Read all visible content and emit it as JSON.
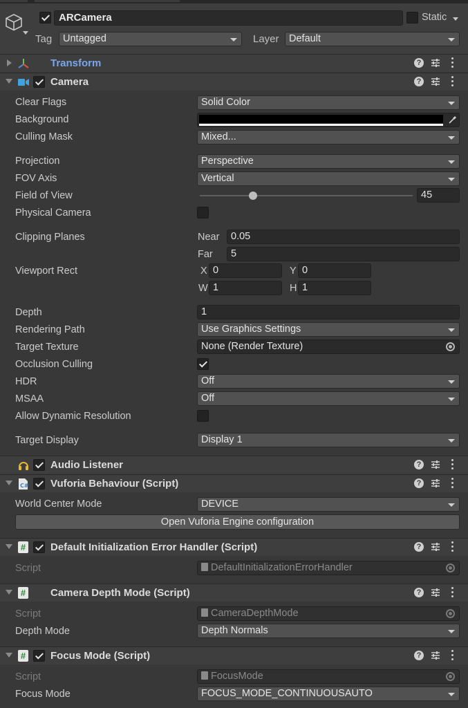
{
  "header": {
    "object_name": "ARCamera",
    "static_label": "Static",
    "tag_label": "Tag",
    "tag_value": "Untagged",
    "layer_label": "Layer",
    "layer_value": "Default"
  },
  "transform": {
    "title": "Transform"
  },
  "camera": {
    "title": "Camera",
    "clear_flags": {
      "label": "Clear Flags",
      "value": "Solid Color"
    },
    "background": {
      "label": "Background",
      "color": "#000000"
    },
    "culling_mask": {
      "label": "Culling Mask",
      "value": "Mixed..."
    },
    "projection": {
      "label": "Projection",
      "value": "Perspective"
    },
    "fov_axis": {
      "label": "FOV Axis",
      "value": "Vertical"
    },
    "field_of_view": {
      "label": "Field of View",
      "value": "45",
      "slider_fraction": 0.25
    },
    "physical_camera": {
      "label": "Physical Camera",
      "checked": false
    },
    "clipping_planes": {
      "label": "Clipping Planes",
      "near_label": "Near",
      "near_value": "0.05",
      "far_label": "Far",
      "far_value": "5"
    },
    "viewport_rect": {
      "label": "Viewport Rect",
      "x_label": "X",
      "x_value": "0",
      "y_label": "Y",
      "y_value": "0",
      "w_label": "W",
      "w_value": "1",
      "h_label": "H",
      "h_value": "1"
    },
    "depth": {
      "label": "Depth",
      "value": "1"
    },
    "rendering_path": {
      "label": "Rendering Path",
      "value": "Use Graphics Settings"
    },
    "target_texture": {
      "label": "Target Texture",
      "value": "None (Render Texture)"
    },
    "occlusion_culling": {
      "label": "Occlusion Culling",
      "checked": true
    },
    "hdr": {
      "label": "HDR",
      "value": "Off"
    },
    "msaa": {
      "label": "MSAA",
      "value": "Off"
    },
    "allow_dynamic_resolution": {
      "label": "Allow Dynamic Resolution",
      "checked": false
    },
    "target_display": {
      "label": "Target Display",
      "value": "Display 1"
    }
  },
  "audio_listener": {
    "title": "Audio Listener"
  },
  "vuforia": {
    "title": "Vuforia Behaviour (Script)",
    "world_center_mode": {
      "label": "World Center Mode",
      "value": "DEVICE"
    },
    "config_button": "Open Vuforia Engine configuration"
  },
  "default_init": {
    "title": "Default Initialization Error Handler (Script)",
    "script_label": "Script",
    "script_value": "DefaultInitializationErrorHandler"
  },
  "camera_depth": {
    "title": "Camera Depth Mode (Script)",
    "script_label": "Script",
    "script_value": "CameraDepthMode",
    "depth_mode": {
      "label": "Depth Mode",
      "value": "Depth Normals"
    }
  },
  "focus_mode": {
    "title": "Focus Mode (Script)",
    "script_label": "Script",
    "script_value": "FocusMode",
    "mode": {
      "label": "Focus Mode",
      "value": "FOCUS_MODE_CONTINUOUSAUTO"
    }
  },
  "colors": {
    "panel": "#383838",
    "header": "#3e3e3e",
    "field": "#2a2a2a",
    "dropdown": "#515151",
    "transform_title": "#7aa6e8",
    "hash_green": "#2b8a3e"
  }
}
